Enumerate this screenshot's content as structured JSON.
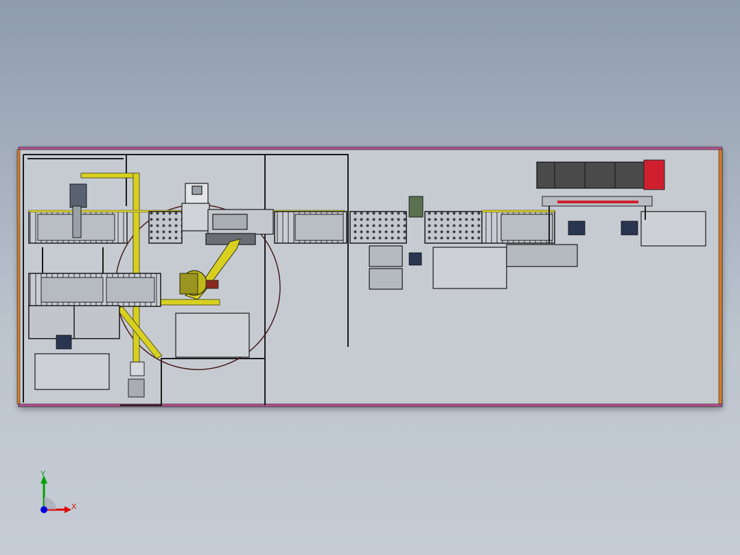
{
  "app": {
    "view": "top"
  },
  "triad": {
    "x_label": "X",
    "y_label": "Y",
    "x_color": "#e00000",
    "y_color": "#00a000",
    "z_color": "#0000e0"
  },
  "colors": {
    "background_top": "#8f9cae",
    "background_bottom": "#c5ccd5",
    "frame_magenta": "#b0508a",
    "frame_orange": "#d07a2a",
    "robot_yellow": "#d8d020",
    "accent_red": "#d02030",
    "machine_dark": "#4a4a4a",
    "equipment_green": "#5a7050"
  }
}
